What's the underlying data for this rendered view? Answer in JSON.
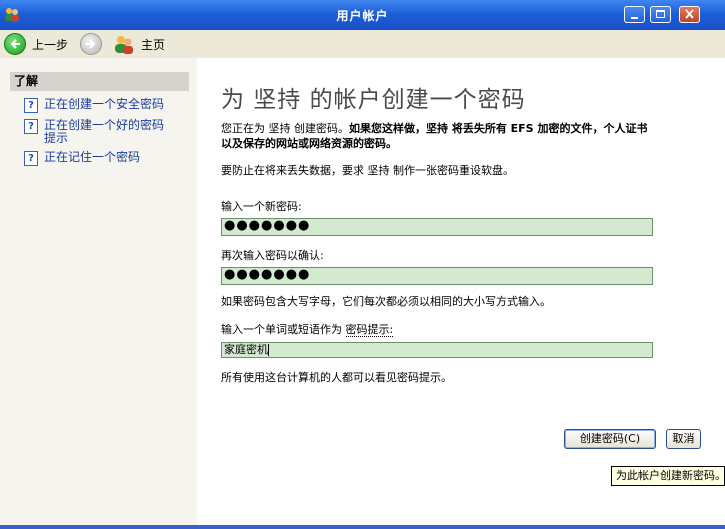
{
  "window": {
    "title": "用户帐户"
  },
  "toolbar": {
    "back_label": "上一步",
    "home_label": "主页"
  },
  "sidebar": {
    "header": "了解",
    "items": [
      {
        "label": "正在创建一个安全密码"
      },
      {
        "label": "正在创建一个好的密码提示"
      },
      {
        "label": "正在记住一个密码"
      }
    ]
  },
  "main": {
    "headline": "为 坚持 的帐户创建一个密码",
    "intro_normal": "您正在为 坚持 创建密码。",
    "intro_bold": "如果您这样做，坚持 将丢失所有 EFS 加密的文件，个人证书以及保存的网站或网络资源的密码。",
    "reset_note": "要防止在将来丢失数据，要求 坚持 制作一张密码重设软盘。",
    "new_password_label": "输入一个新密码:",
    "new_password_value": "●●●●●●●",
    "confirm_label": "再次输入密码以确认:",
    "confirm_value": "●●●●●●●",
    "case_note": "如果密码包含大写字母，它们每次都必须以相同的大小写方式输入。",
    "hint_label_prefix": "输入一个单词或短语作为 ",
    "hint_label_link": "密码提示:",
    "hint_value": "家庭密机",
    "hint_note": "所有使用这台计算机的人都可以看见密码提示。",
    "create_button": "创建密码(C)",
    "cancel_button": "取消",
    "tooltip": "为此帐户创建新密码。"
  }
}
